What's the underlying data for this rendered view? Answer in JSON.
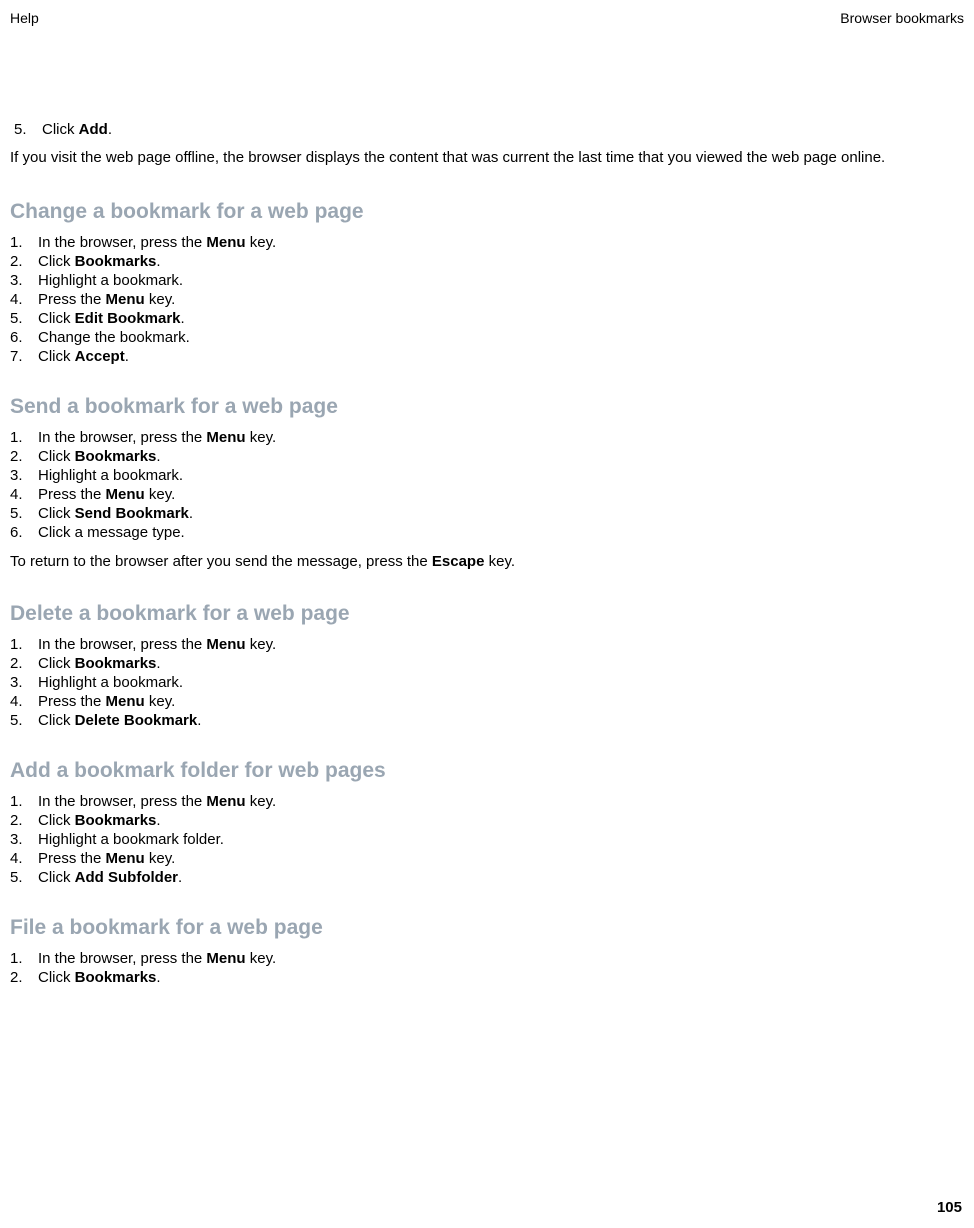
{
  "header": {
    "left": "Help",
    "right": "Browser bookmarks"
  },
  "topStep": {
    "num": "5.",
    "pre": "Click ",
    "bold": "Add",
    "post": "."
  },
  "topParagraph": "If you visit the web page offline, the browser displays the content that was current the last time that you viewed the web page online.",
  "sections": [
    {
      "title": "Change a bookmark for a web page",
      "steps": [
        {
          "num": "1.",
          "pre": "In the browser, press the ",
          "bold": "Menu",
          "post": " key."
        },
        {
          "num": "2.",
          "pre": "Click ",
          "bold": "Bookmarks",
          "post": "."
        },
        {
          "num": "3.",
          "pre": "Highlight a bookmark.",
          "bold": "",
          "post": ""
        },
        {
          "num": "4.",
          "pre": "Press the ",
          "bold": "Menu",
          "post": " key."
        },
        {
          "num": "5.",
          "pre": "Click ",
          "bold": "Edit Bookmark",
          "post": "."
        },
        {
          "num": "6.",
          "pre": "Change the bookmark.",
          "bold": "",
          "post": ""
        },
        {
          "num": "7.",
          "pre": "Click ",
          "bold": "Accept",
          "post": "."
        }
      ],
      "postPara": ""
    },
    {
      "title": "Send a bookmark for a web page",
      "steps": [
        {
          "num": "1.",
          "pre": "In the browser, press the ",
          "bold": "Menu",
          "post": " key."
        },
        {
          "num": "2.",
          "pre": "Click ",
          "bold": "Bookmarks",
          "post": "."
        },
        {
          "num": "3.",
          "pre": "Highlight a bookmark.",
          "bold": "",
          "post": ""
        },
        {
          "num": "4.",
          "pre": "Press the ",
          "bold": "Menu",
          "post": " key."
        },
        {
          "num": "5.",
          "pre": "Click ",
          "bold": "Send Bookmark",
          "post": "."
        },
        {
          "num": "6.",
          "pre": "Click a message type.",
          "bold": "",
          "post": ""
        }
      ],
      "postParaPre": "To return to the browser after you send the message, press the ",
      "postParaBold": "Escape",
      "postParaPost": " key."
    },
    {
      "title": "Delete a bookmark for a web page",
      "steps": [
        {
          "num": "1.",
          "pre": "In the browser, press the ",
          "bold": "Menu",
          "post": " key."
        },
        {
          "num": "2.",
          "pre": "Click ",
          "bold": "Bookmarks",
          "post": "."
        },
        {
          "num": "3.",
          "pre": "Highlight a bookmark.",
          "bold": "",
          "post": ""
        },
        {
          "num": "4.",
          "pre": "Press the ",
          "bold": "Menu",
          "post": " key."
        },
        {
          "num": "5.",
          "pre": "Click ",
          "bold": "Delete Bookmark",
          "post": "."
        }
      ],
      "postPara": ""
    },
    {
      "title": "Add a bookmark folder for web pages",
      "steps": [
        {
          "num": "1.",
          "pre": "In the browser, press the ",
          "bold": "Menu",
          "post": " key."
        },
        {
          "num": "2.",
          "pre": "Click ",
          "bold": "Bookmarks",
          "post": "."
        },
        {
          "num": "3.",
          "pre": "Highlight a bookmark folder.",
          "bold": "",
          "post": ""
        },
        {
          "num": "4.",
          "pre": "Press the ",
          "bold": "Menu",
          "post": " key."
        },
        {
          "num": "5.",
          "pre": "Click ",
          "bold": "Add Subfolder",
          "post": "."
        }
      ],
      "postPara": ""
    },
    {
      "title": "File a bookmark for a web page",
      "steps": [
        {
          "num": "1.",
          "pre": "In the browser, press the ",
          "bold": "Menu",
          "post": " key."
        },
        {
          "num": "2.",
          "pre": "Click ",
          "bold": "Bookmarks",
          "post": "."
        }
      ],
      "postPara": ""
    }
  ],
  "pageNumber": "105"
}
